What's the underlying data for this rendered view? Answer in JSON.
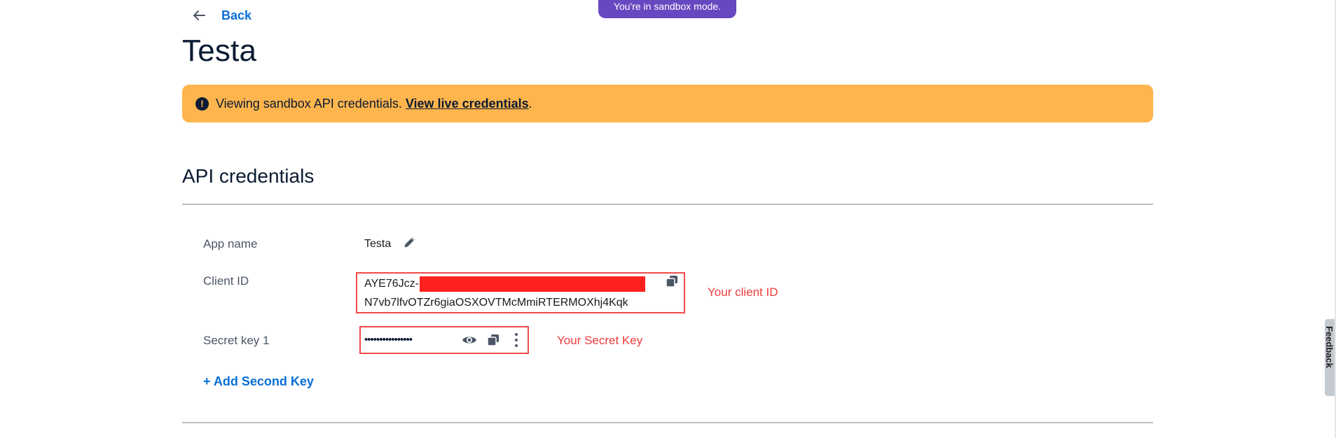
{
  "sandbox_notice": "You're in sandbox mode.",
  "nav": {
    "back_label": "Back",
    "back_icon": "arrow-left-icon"
  },
  "page": {
    "title": "Testa"
  },
  "banner": {
    "icon": "exclamation-circle-icon",
    "text": "Viewing sandbox API credentials.",
    "link_label": "View live credentials",
    "suffix": ".",
    "color": "#ffb54d"
  },
  "credentials": {
    "section_title": "API credentials",
    "app_name": {
      "label": "App name",
      "value": "Testa",
      "edit_icon": "pencil-icon"
    },
    "client_id": {
      "label": "Client ID",
      "value_prefix": "AYE76Jcz-",
      "value_line2": "N7vb7lfvOTZr6giaOSXOVTMcMmiRTERMOXhj4Kqk",
      "copy_icon": "copy-icon",
      "annotation": "Your client ID"
    },
    "secret_key": {
      "label": "Secret key 1",
      "masked_value": "••••••••••••••••",
      "reveal_icon": "eye-icon",
      "copy_icon": "copy-icon",
      "more_icon": "more-vertical-icon",
      "annotation": "Your Secret Key"
    },
    "add_key_label": "+ Add Second Key"
  },
  "feedback_tab": {
    "label": "Feedback"
  },
  "colors": {
    "accent": "#0a6fd6",
    "sandbox": "#6848c0",
    "annotation": "#ef3b3b"
  }
}
